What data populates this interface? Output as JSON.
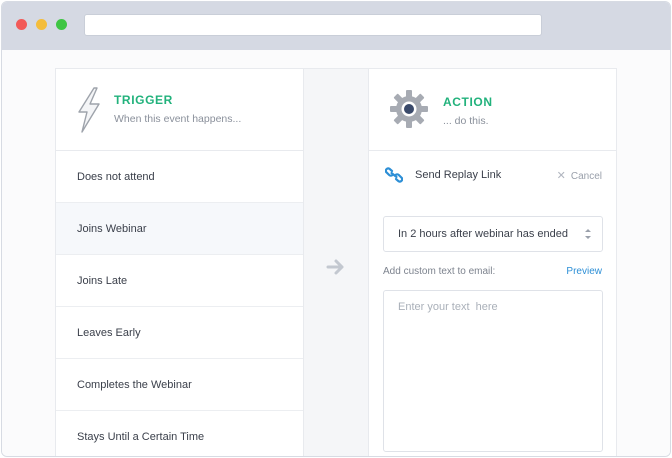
{
  "trigger": {
    "title": "TRIGGER",
    "subtitle": "When this event happens...",
    "icon": "lightning-bolt-icon",
    "events": [
      {
        "label": "Does not attend",
        "selected": false
      },
      {
        "label": "Joins Webinar",
        "selected": true
      },
      {
        "label": "Joins Late",
        "selected": false
      },
      {
        "label": "Leaves Early",
        "selected": false
      },
      {
        "label": "Completes the Webinar",
        "selected": false
      },
      {
        "label": "Stays Until a Certain Time",
        "selected": false
      }
    ]
  },
  "action": {
    "title": "ACTION",
    "subtitle": "... do this.",
    "icon": "gear-icon",
    "name": "Send Replay Link",
    "name_icon": "link-icon",
    "cancel_label": "Cancel",
    "timing_value": "In 2 hours after webinar has ended",
    "custom_text_label": "Add custom text to email:",
    "preview_label": "Preview",
    "text_placeholder": "Enter your text  here"
  },
  "colors": {
    "accent": "#22b27c",
    "link": "#2d8fd6",
    "titlebar": "#d5d9e3"
  }
}
